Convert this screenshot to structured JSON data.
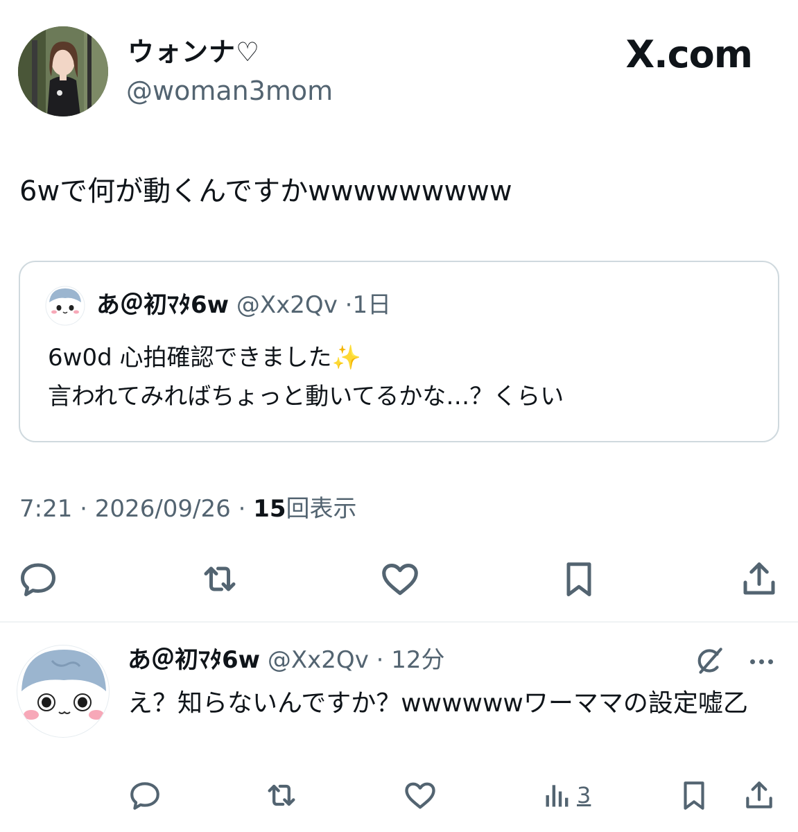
{
  "author": {
    "display_name": "ウォンナ♡",
    "handle": "@woman3mom"
  },
  "brand": {
    "label": "X.com"
  },
  "tweet": {
    "text": "6wで何が動くんですかwwwwwwwww"
  },
  "quoted": {
    "name": "あ＠初ﾏﾀ6w",
    "handle": "@Xx2Qv",
    "separator": "·",
    "time": "1日",
    "line1": "6w0d 心拍確認できました✨",
    "line2": "言われてみればちょっと動いてるかな…？くらい"
  },
  "meta": {
    "time": "7:21",
    "dot": "·",
    "date": "2026/09/26",
    "views_count": "15",
    "views_label": "回表示"
  },
  "actions": {
    "reply": "reply-icon",
    "repost": "repost-icon",
    "like": "heart-icon",
    "bookmark": "bookmark-icon",
    "share": "share-icon"
  },
  "reply": {
    "name": "あ＠初ﾏﾀ6w",
    "handle": "@Xx2Qv",
    "separator": "·",
    "time": "12分",
    "text": "え？知らないんですか？wwwwwwワーママの設定嘘乙",
    "views": "3"
  },
  "colors": {
    "text": "#0f1419",
    "secondary": "#536471",
    "border": "#cfd9de",
    "divider": "#eff3f4",
    "character_hair": "#9bb5cf",
    "character_cheek": "#f7a8b8"
  }
}
